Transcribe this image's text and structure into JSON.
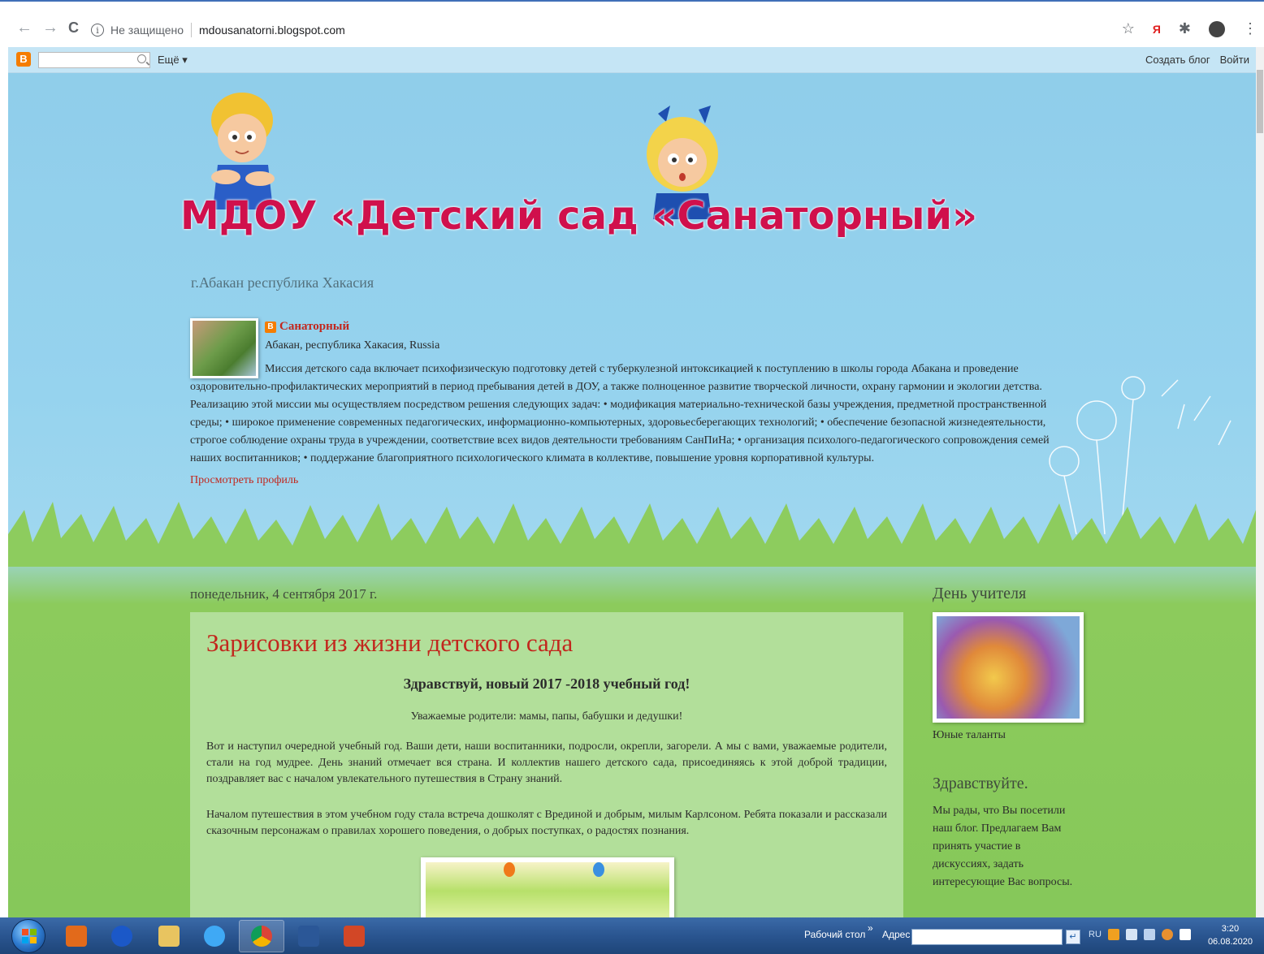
{
  "browser": {
    "not_secure": "Не защищено",
    "url": "mdousanatorni.blogspot.com"
  },
  "navbar": {
    "more": "Ещё ▾",
    "create_blog": "Создать блог",
    "login": "Войти"
  },
  "header": {
    "title": "МДОУ «Детский сад «Санаторный»",
    "subtitle": "г.Абакан республика Хакасия"
  },
  "profile": {
    "name": "Санаторный",
    "location": "Абакан, республика Хакасия, Russia",
    "description": "Миссия детского сада включает психофизическую подготовку детей с туберкулезной интоксикацией к поступлению в школы города Абакана и проведение оздоровительно-профилактических мероприятий в период пребывания детей в ДОУ, а также полноценное развитие творческой личности, охрану гармонии и экологии детства. Реализацию этой миссии мы осуществляем посредством решения следующих задач: • модификация материально-технической базы учреждения, предметной пространственной среды; • широкое применение современных педагогических, информационно-компьютерных, здоровьесберегающих технологий; • обеспечение безопасной жизнедеятельности, строгое соблюдение охраны труда в учреждении, соответствие всех видов деятельности требованиям СанПиНа; • организация психолого-педагогического сопровождения семей наших воспитанников; • поддержание благоприятного психологического климата в коллективе, повышение уровня корпоративной культуры.",
    "view_profile": "Просмотреть профиль"
  },
  "post": {
    "date": "понедельник, 4 сентября 2017 г.",
    "title": "Зарисовки из жизни детского сада",
    "heading": "Здравствуй, новый 2017 -2018 учебный год!",
    "greeting": "Уважаемые родители: мамы, папы, бабушки и дедушки!",
    "paragraph1": "Вот и наступил очередной учебный год. Ваши дети, наши воспитанники,  подросли, окрепли, загорели. А мы с вами, уважаемые родители, стали на год мудрее. День знаний отмечает вся страна. И коллектив нашего детского сада, присоединяясь к этой доброй традиции, поздравляет вас с началом увлекательного путешествия в Страну знаний.",
    "paragraph2": "Началом путешествия в этом учебном году стала встреча дошколят с Врединой и добрым, милым Карлсоном. Ребята показали и рассказали сказочным персонажам о правилах хорошего поведения, о добрых поступках,  о радостях познания."
  },
  "sidebar": {
    "widget1_title": "День учителя",
    "widget1_caption": "Юные таланты",
    "widget2_title": "Здравствуйте.",
    "widget2_text": "Мы рады, что Вы посетили наш блог. Предлагаем Вам принять участие в дискуссиях, задать интересующие Вас вопросы."
  },
  "taskbar": {
    "desktop": "Рабочий стол",
    "address_label": "Адрес",
    "lang": "RU",
    "time": "3:20",
    "date": "06.08.2020"
  }
}
